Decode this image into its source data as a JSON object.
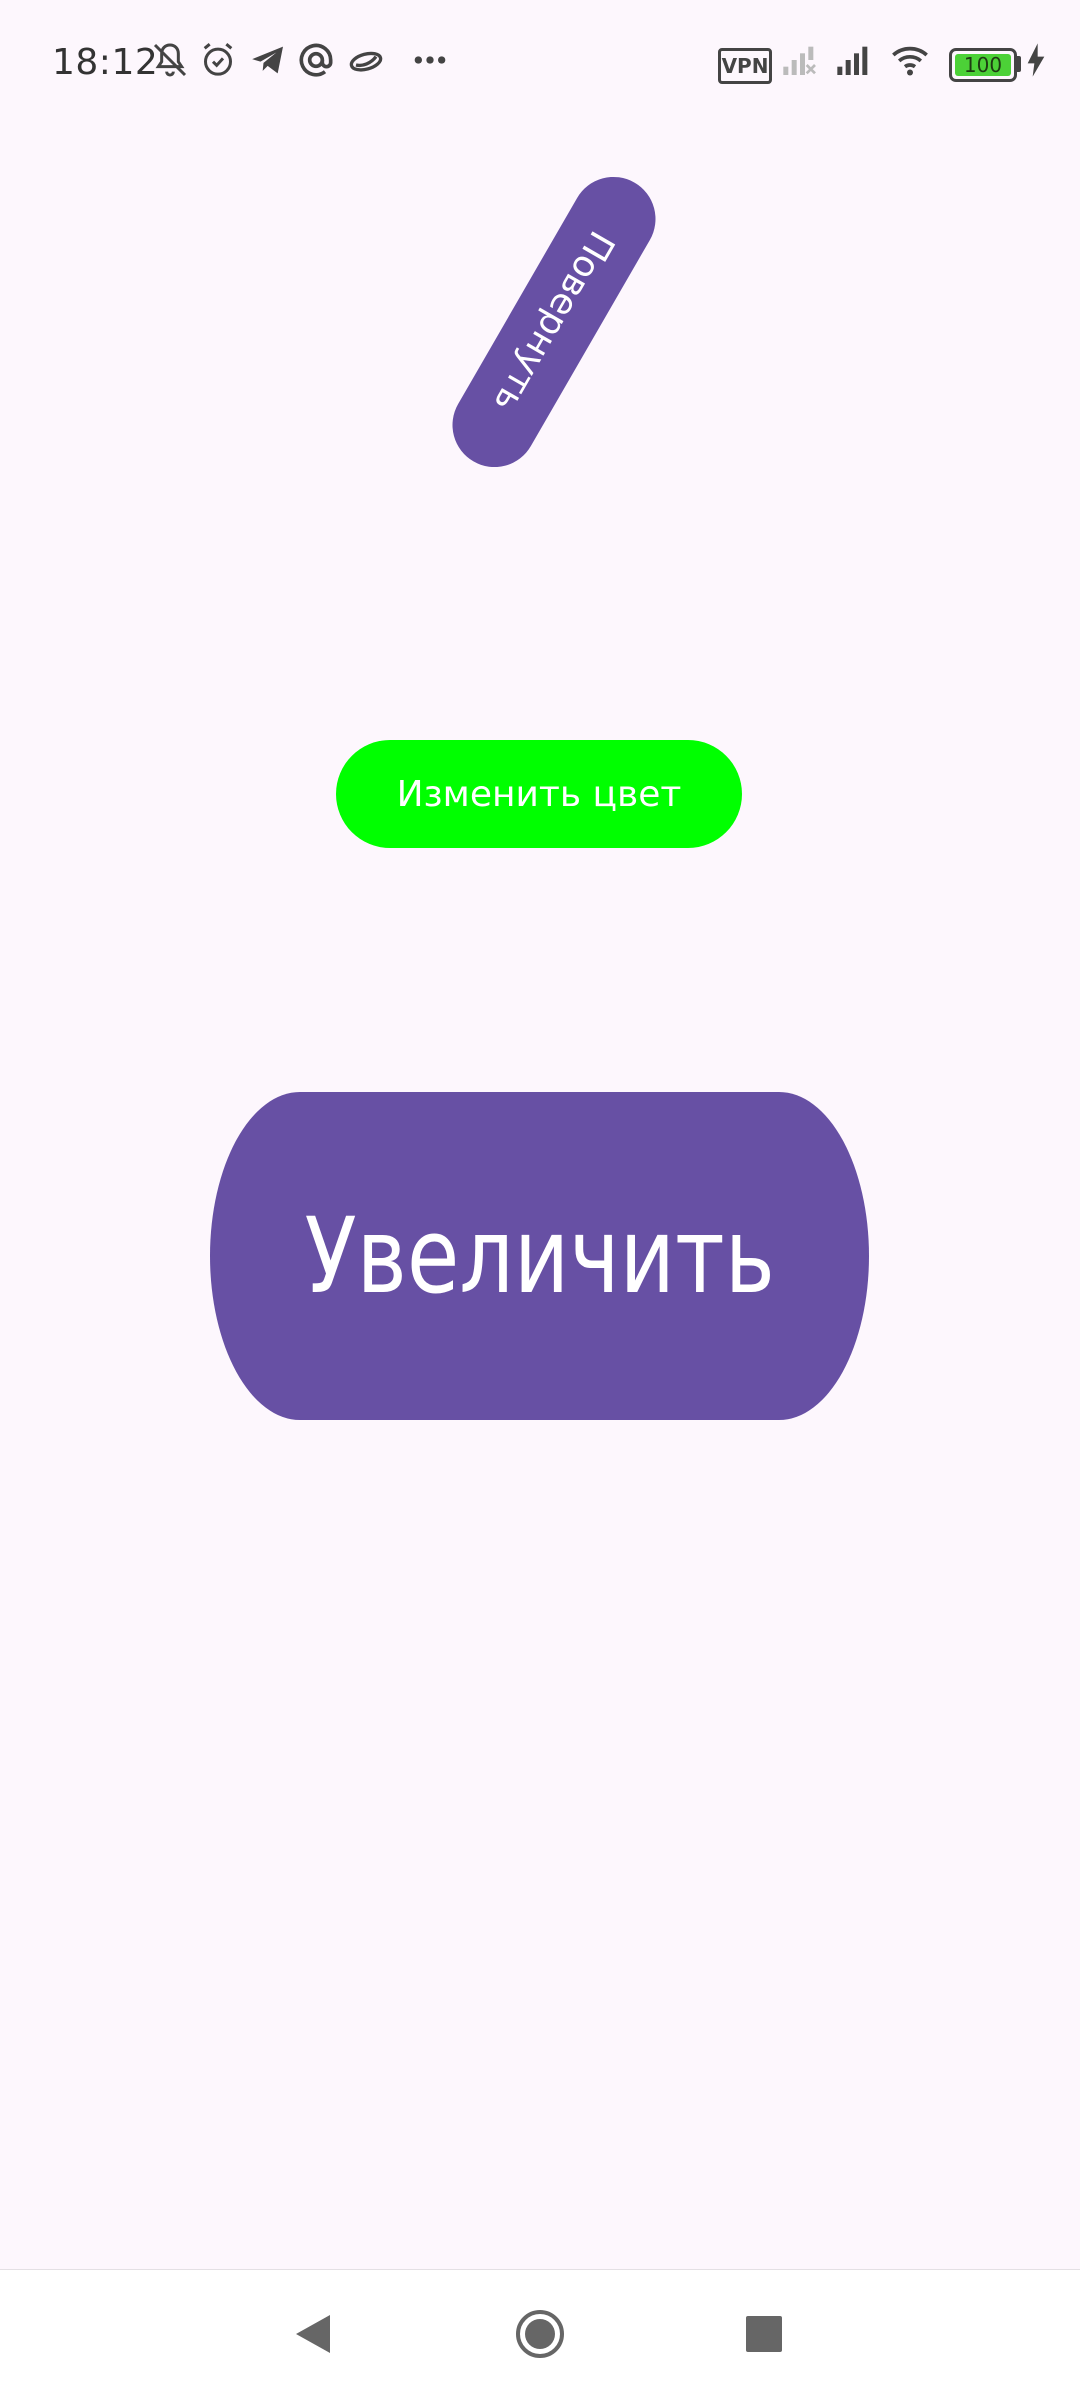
{
  "status_bar": {
    "time": "18:12",
    "vpn_label": "VPN",
    "battery_level": "100",
    "icons": [
      "bell-off-icon",
      "alarm-icon",
      "telegram-icon",
      "at-icon",
      "cloud-icon",
      "more-icon",
      "signal-icon",
      "signal-icon",
      "wifi-icon",
      "battery-icon",
      "charging-icon"
    ]
  },
  "buttons": {
    "rotate_label": "Повернуть",
    "color_label": "Изменить цвет",
    "enlarge_label": "Увеличить"
  },
  "colors": {
    "background": "#fdf7fd",
    "primary": "#6750a4",
    "color_button": "#00ff00",
    "text_on_button": "#ffffff"
  },
  "nav_bar": {
    "icons": [
      "back-icon",
      "home-icon",
      "recent-apps-icon"
    ]
  }
}
